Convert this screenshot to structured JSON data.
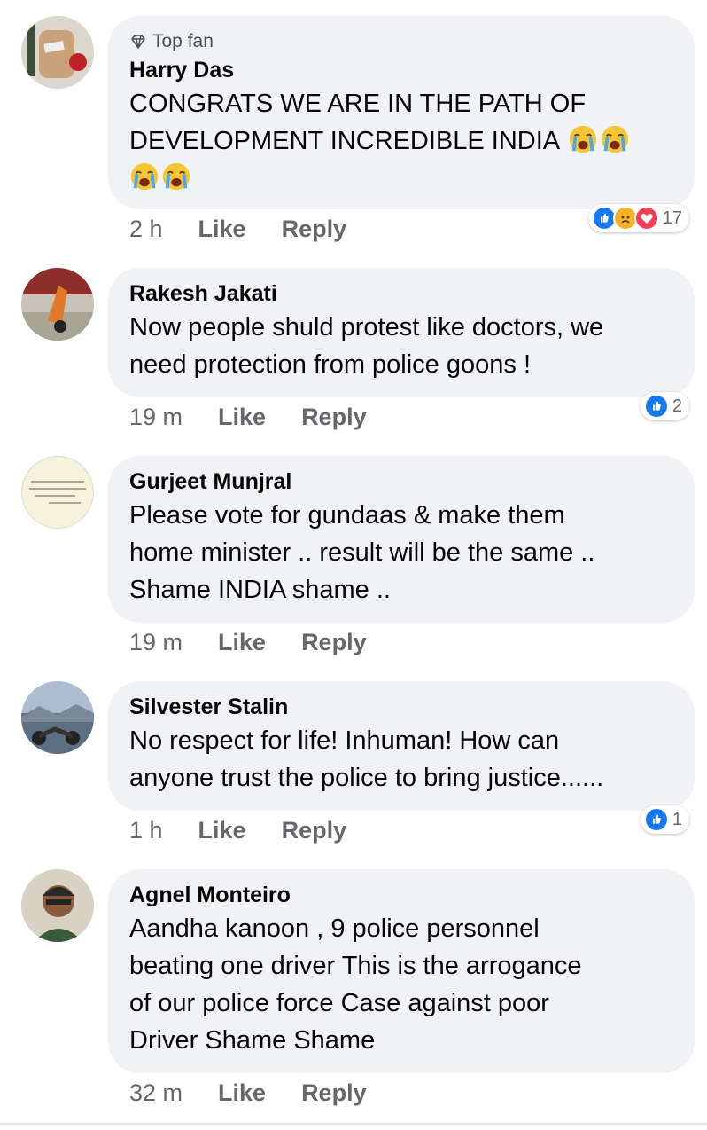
{
  "comments": [
    {
      "badge": "Top fan",
      "author": "Harry Das",
      "lines": [
        "CONGRATS WE ARE IN THE PATH OF",
        "DEVELOPMENT INCREDIBLE INDIA"
      ],
      "time": "2 h",
      "like_label": "Like",
      "reply_label": "Reply",
      "reaction_count": "17",
      "reactions": [
        "like-icon",
        "sad-icon",
        "love-icon"
      ]
    },
    {
      "author": "Rakesh Jakati",
      "lines": [
        "Now people shuld protest like doctors, we",
        "need protection from police goons !"
      ],
      "time": "19 m",
      "like_label": "Like",
      "reply_label": "Reply",
      "reaction_count": "2",
      "reactions": [
        "like-icon"
      ]
    },
    {
      "author": "Gurjeet Munjral",
      "lines": [
        "Please vote for gundaas & make them",
        "home minister .. result will be the same ..",
        "Shame INDIA shame .."
      ],
      "time": "19 m",
      "like_label": "Like",
      "reply_label": "Reply"
    },
    {
      "author": "Silvester Stalin",
      "lines": [
        "No respect for life! Inhuman! How can",
        "anyone trust the police to bring justice......"
      ],
      "time": "1 h",
      "like_label": "Like",
      "reply_label": "Reply",
      "reaction_count": "1",
      "reactions": [
        "like-icon"
      ]
    },
    {
      "author": "Agnel Monteiro",
      "lines": [
        "Aandha kanoon , 9 police personnel",
        "beating one driver This is the arrogance",
        "of our police force Case against poor",
        "Driver Shame Shame"
      ],
      "time": "32 m",
      "like_label": "Like",
      "reply_label": "Reply"
    }
  ],
  "colors": {
    "bubble": "#f0f2f5",
    "meta_text": "#65676b",
    "like_blue": "#1877f2",
    "love_red": "#f33e58",
    "sad_yellow": "#f7b125"
  }
}
